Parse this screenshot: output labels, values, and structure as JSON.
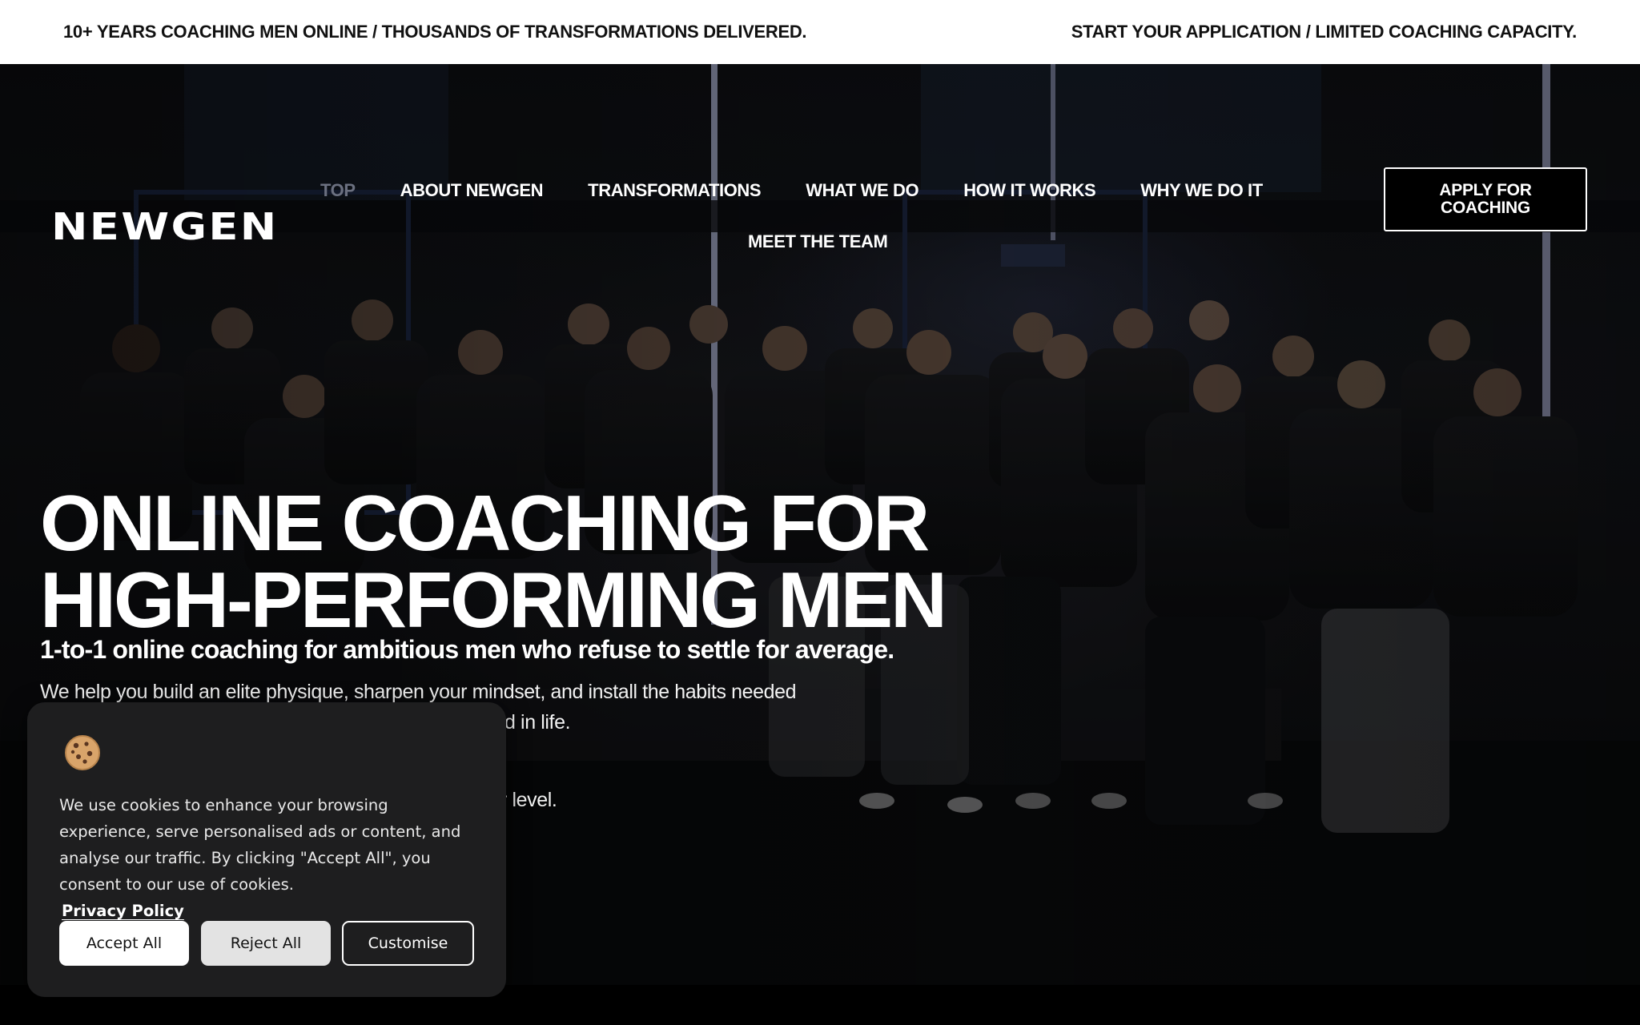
{
  "announcement": {
    "left": "10+ YEARS COACHING MEN ONLINE / THOUSANDS OF TRANSFORMATIONS DELIVERED.",
    "right": "START YOUR APPLICATION / LIMITED COACHING CAPACITY."
  },
  "header": {
    "logo": "NEWGEN",
    "nav": [
      "TOP",
      "ABOUT NEWGEN",
      "TRANSFORMATIONS",
      "WHAT WE DO",
      "HOW IT WORKS",
      "WHY WE DO IT",
      "MEET THE TEAM"
    ],
    "cta_line1": "APPLY FOR",
    "cta_line2": "COACHING"
  },
  "hero": {
    "headline_line1": "ONLINE COACHING FOR",
    "headline_line2": "HIGH-PERFORMING MEN",
    "subheadline": "1-to-1 online coaching for ambitious men who refuse to settle for average.",
    "body_line1": "We help you build an elite physique, sharpen your mindset, and install the habits needed",
    "body_line2_visible": "d in life.",
    "body_line3_visible": "r level."
  },
  "cookie_banner": {
    "icon": "cookie-icon",
    "text": "We use cookies to enhance your browsing experience, serve personalised ads or content, and analyse our traffic. By clicking \"Accept All\", you consent to our use of cookies.",
    "privacy_link": "Privacy Policy",
    "accept": "Accept All",
    "reject": "Reject All",
    "customise": "Customise"
  },
  "colors": {
    "announcement_bg": "#ffffff",
    "hero_bg": "#101114",
    "cookie_bg": "#1e1e1f",
    "nav_active": "#6b7080"
  }
}
